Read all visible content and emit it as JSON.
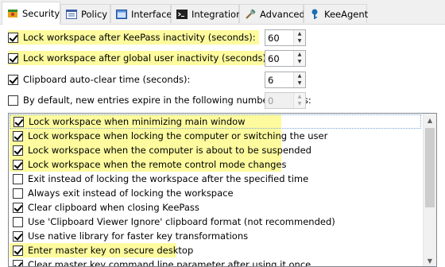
{
  "tabs": [
    {
      "label": "Security",
      "icon": "security-shield-icon",
      "active": true
    },
    {
      "label": "Policy",
      "icon": "policy-list-icon"
    },
    {
      "label": "Interface",
      "icon": "interface-window-icon"
    },
    {
      "label": "Integration",
      "icon": "integration-console-icon"
    },
    {
      "label": "Advanced",
      "icon": "advanced-tools-icon"
    },
    {
      "label": "KeeAgent",
      "icon": "keeagent-key-icon"
    }
  ],
  "options": {
    "lock_keepass_inactivity": {
      "label": "Lock workspace after KeePass inactivity (seconds):",
      "checked": true,
      "value": "60"
    },
    "lock_global_inactivity": {
      "label": "Lock workspace after global user inactivity (seconds):",
      "checked": true,
      "value": "60"
    },
    "clipboard_clear": {
      "label": "Clipboard auto-clear time (seconds):",
      "checked": true,
      "value": "6"
    },
    "default_expire": {
      "label": "By default, new entries expire in the following number of days:",
      "checked": false,
      "value": "0"
    }
  },
  "list_items": [
    {
      "label": "Lock workspace when minimizing main window",
      "checked": true
    },
    {
      "label": "Lock workspace when locking the computer or switching the user",
      "checked": true
    },
    {
      "label": "Lock workspace when the computer is about to be suspended",
      "checked": true
    },
    {
      "label": "Lock workspace when the remote control mode changes",
      "checked": true
    },
    {
      "label": "Exit instead of locking the workspace after the specified time",
      "checked": false
    },
    {
      "label": "Always exit instead of locking the workspace",
      "checked": false
    },
    {
      "label": "Clear clipboard when closing KeePass",
      "checked": true
    },
    {
      "label": "Use 'Clipboard Viewer Ignore' clipboard format (not recommended)",
      "checked": false
    },
    {
      "label": "Use native library for faster key transformations",
      "checked": true
    },
    {
      "label": "Enter master key on secure desktop",
      "checked": true
    },
    {
      "label": "Clear master key command line parameter after using it once",
      "checked": true
    }
  ],
  "colors": {
    "highlight": "#fdfb9e"
  }
}
